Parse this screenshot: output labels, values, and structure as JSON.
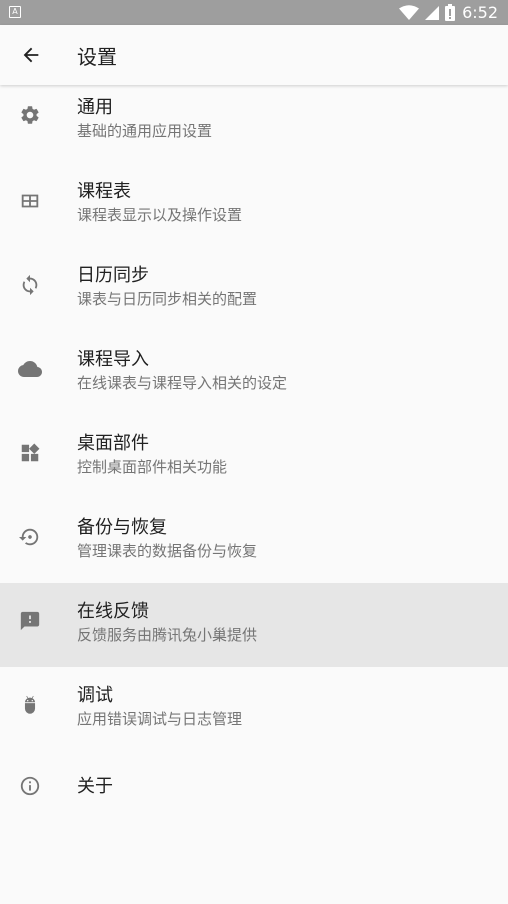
{
  "status_bar": {
    "app_icon_letter": "A",
    "time": "6:52",
    "icons": [
      "wifi-icon",
      "signal-icon",
      "battery-icon"
    ]
  },
  "app_bar": {
    "back_icon": "arrow-left-icon",
    "title": "设置"
  },
  "settings": [
    {
      "icon": "gear-icon",
      "title": "通用",
      "subtitle": "基础的通用应用设置"
    },
    {
      "icon": "table-icon",
      "title": "课程表",
      "subtitle": "课程表显示以及操作设置"
    },
    {
      "icon": "sync-icon",
      "title": "日历同步",
      "subtitle": "课表与日历同步相关的配置"
    },
    {
      "icon": "cloud-icon",
      "title": "课程导入",
      "subtitle": "在线课表与课程导入相关的设定"
    },
    {
      "icon": "widgets-icon",
      "title": "桌面部件",
      "subtitle": "控制桌面部件相关功能"
    },
    {
      "icon": "restore-icon",
      "title": "备份与恢复",
      "subtitle": "管理课表的数据备份与恢复"
    },
    {
      "icon": "feedback-icon",
      "title": "在线反馈",
      "subtitle": "反馈服务由腾讯兔小巢提供"
    },
    {
      "icon": "android-icon",
      "title": "调试",
      "subtitle": "应用错误调试与日志管理"
    },
    {
      "icon": "info-icon",
      "title": "关于",
      "subtitle": ""
    }
  ],
  "colors": {
    "status_bar": "#9e9e9e",
    "background": "#fafafa",
    "highlight_row": "#e6e6e6",
    "icon": "#757575",
    "title_text": "#212121",
    "subtitle_text": "#757575"
  }
}
